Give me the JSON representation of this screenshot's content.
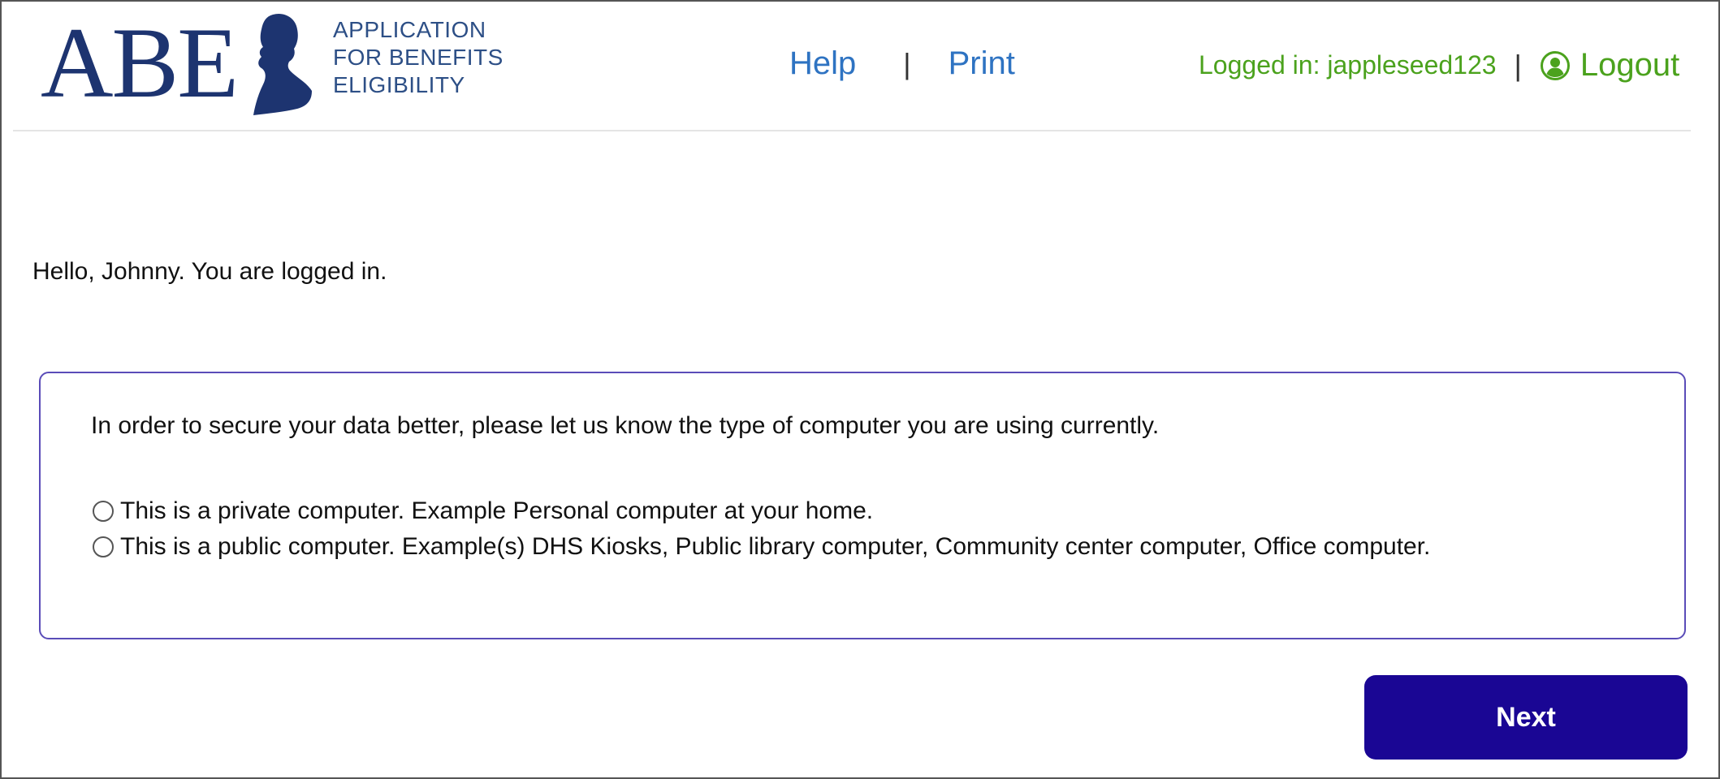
{
  "header": {
    "logo_letters": "ABE",
    "logo_lines": [
      "APPLICATION",
      "FOR BENEFITS",
      "ELIGIBILITY"
    ],
    "nav": {
      "help": "Help",
      "separator": "|",
      "print": "Print"
    },
    "user": {
      "logged_in_text": "Logged in: jappleseed123",
      "separator": "|",
      "logout_label": "Logout",
      "logout_icon": "user-circle-icon"
    }
  },
  "main": {
    "greeting": "Hello, Johnny. You are logged in.",
    "prompt": "In order to secure your data better, please let us know the type of computer you are using currently.",
    "options": [
      {
        "label": "This is a private computer. Example Personal computer at your home.",
        "selected": false
      },
      {
        "label": "This is a public computer. Example(s) DHS Kiosks, Public library computer, Community center computer, Office computer.",
        "selected": false
      }
    ],
    "next_label": "Next"
  },
  "colors": {
    "logo_navy": "#1d3470",
    "link_blue": "#2e73c2",
    "user_green": "#4ba21d",
    "panel_border": "#5a4cb8",
    "button_purple": "#1a0694"
  }
}
